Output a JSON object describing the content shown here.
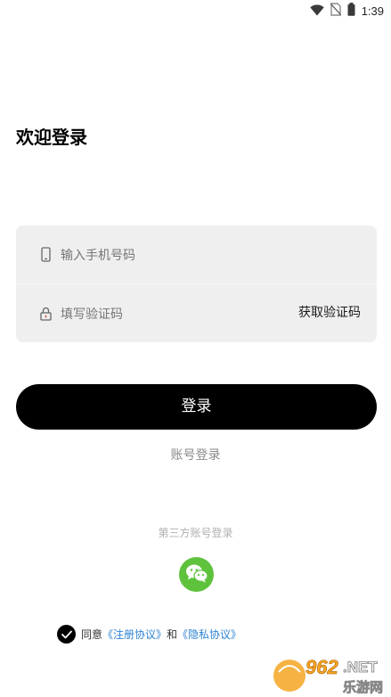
{
  "status_bar": {
    "time": "1:39",
    "icons": [
      "wifi-icon",
      "no-sim-icon",
      "battery-icon"
    ]
  },
  "title": "欢迎登录",
  "form": {
    "phone": {
      "placeholder": "输入手机号码",
      "icon": "phone-icon"
    },
    "code": {
      "placeholder": "填写验证码",
      "icon": "lock-icon",
      "action_label": "获取验证码"
    }
  },
  "login_button": "登录",
  "account_login": "账号登录",
  "third_party": {
    "label": "第三方账号登录",
    "icon": "wechat-icon"
  },
  "agreement": {
    "prefix": "同意",
    "terms": "《注册协议》",
    "conjunction": "和",
    "privacy": "《隐私协议》",
    "checked": true
  },
  "watermark": {
    "number": "962",
    "suffix": ".NET",
    "site": "乐游网"
  },
  "colors": {
    "primary": "#000000",
    "input_background": "#efefef",
    "link": "#2d83d3",
    "wechat": "#5ec23c"
  }
}
